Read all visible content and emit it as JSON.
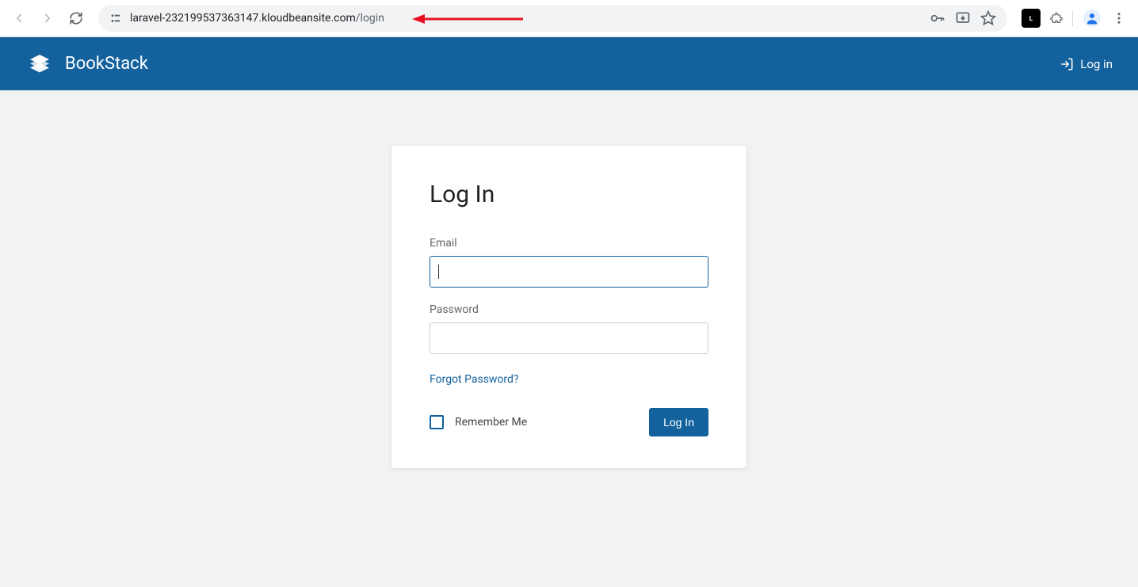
{
  "browser": {
    "url_host": "laravel-232199537363147.kloudbeansite.com",
    "url_path": "/login"
  },
  "header": {
    "app_name": "BookStack",
    "login_link": "Log in"
  },
  "login": {
    "title": "Log In",
    "email_label": "Email",
    "password_label": "Password",
    "forgot_link": "Forgot Password?",
    "remember_label": "Remember Me",
    "submit_label": "Log In"
  }
}
